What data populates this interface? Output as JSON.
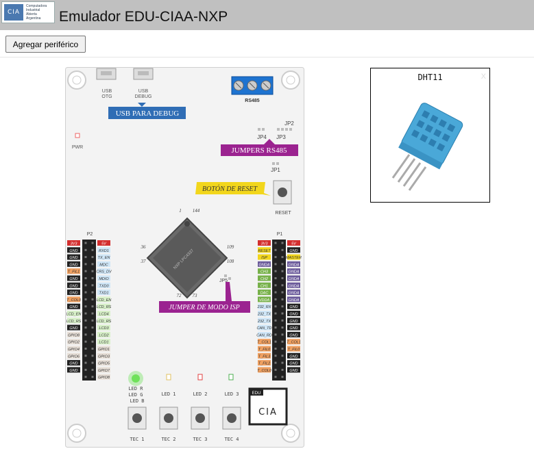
{
  "header": {
    "logo_mark": "CIA",
    "logo_text_lines": [
      "Computadora",
      "Industrial",
      "Abierta",
      "Argentina"
    ],
    "title": "Emulador EDU-CIAA-NXP"
  },
  "toolbar": {
    "add_peripheral_label": "Agregar periférico"
  },
  "board": {
    "usb_otg": "USB OTG",
    "usb_debug": "USB DEBUG",
    "usb_para_debug": "USB PARA DEBUG",
    "rs485": "RS485",
    "jumpers_rs485": "JUMPERS RS485",
    "jp1": "JP1",
    "jp2": "JP2",
    "jp3": "JP3",
    "jp4": "JP4",
    "jp5": "JP5",
    "pwr": "PWR",
    "boton_reset": "BOTÓN DE RESET",
    "reset": "RESET",
    "chip_pins": [
      "1",
      "144",
      "36",
      "37",
      "109",
      "108",
      "72",
      "73"
    ],
    "jumper_modo_isp": "JUMPER DE MODO ISP",
    "p2": "P2",
    "p1": "P1",
    "p2_left": [
      "3V3",
      "GND",
      "GND",
      "GND",
      "T_FIL1",
      "GND",
      "GND",
      "GND",
      "T_COL0",
      "GND",
      "LCD_EN",
      "LCD_RS",
      "GND",
      "GPIO8",
      "GPIO2",
      "GPIO4",
      "GPIO6",
      "GND",
      "GND"
    ],
    "p2_right": [
      "5V",
      "RXD1",
      "TX_EN",
      "MDC",
      "CRS_DV",
      "MDIO",
      "TXD0",
      "TXD1",
      "LCD_EN",
      "LCD_RS",
      "LCD4",
      "LCD_RS",
      "LCD3",
      "LCD2",
      "LCD1",
      "GPIO1",
      "GPIO3",
      "GPIO5",
      "GPIO7",
      "GPIO8"
    ],
    "p1_left": [
      "3V3",
      "RESET",
      "ISP",
      "GNDA",
      "CH3",
      "CH2",
      "CH1",
      "DAC",
      "VDDA",
      "232_RX",
      "232_TX",
      "232_TX",
      "CAN_TD",
      "CAN_RD",
      "T_COL1",
      "T_FIL0",
      "T_FIL3",
      "T_FIL2",
      "T_COL0"
    ],
    "p1_right": [
      "5V",
      "GND",
      "MASTER",
      "GNDA",
      "GNDA",
      "GNDA",
      "GNDA",
      "GNDA",
      "GNDA",
      "GND",
      "GND",
      "GND",
      "GND",
      "GND",
      "T_COL1",
      "T_FIL0",
      "GND",
      "GND",
      "GND"
    ],
    "led_rgb": "LED R\nLED G\nLED B",
    "led1": "LED 1",
    "led2": "LED 2",
    "led3": "LED 3",
    "edu": "EDU",
    "cia": "CIA",
    "tec1": "TEC 1",
    "tec2": "TEC 2",
    "tec3": "TEC 3",
    "tec4": "TEC 4"
  },
  "peripheral": {
    "title": "DHT11",
    "close": "X"
  },
  "colors": {
    "header_bg": "#c0c0c0",
    "usb_label_bg": "#2f6db5",
    "jumper_label_bg": "#9b2390",
    "reset_label_bg": "#f2d61c",
    "led_active": "#6fe15a",
    "sensor_blue": "#4aa8d8"
  }
}
